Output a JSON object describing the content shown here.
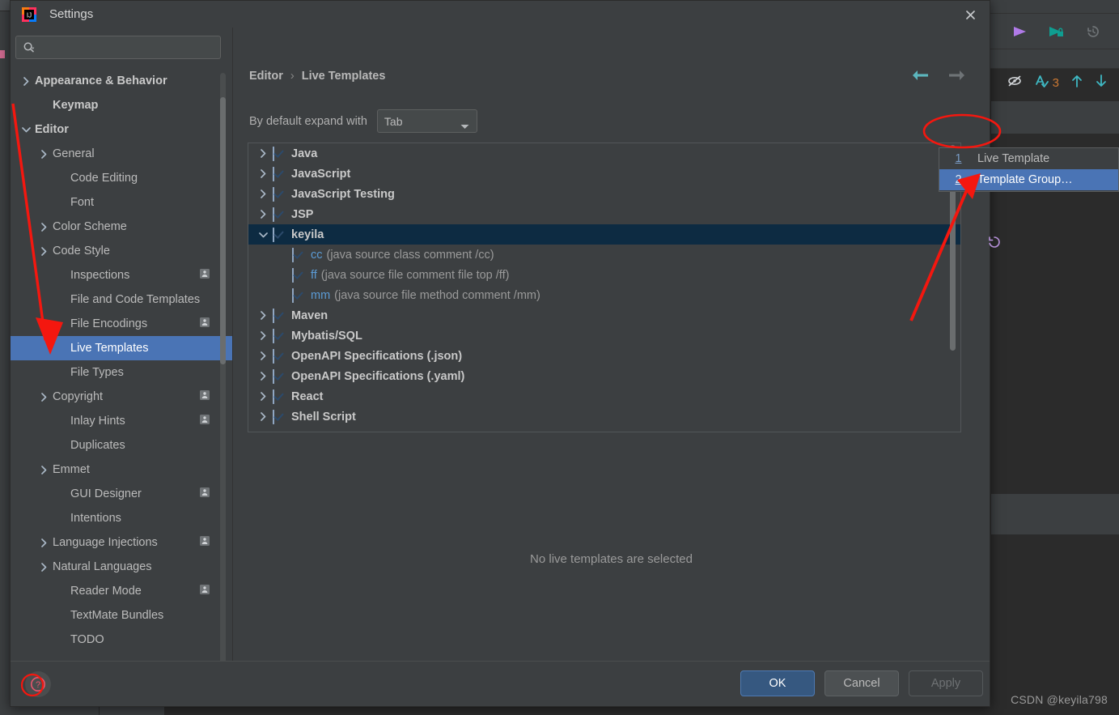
{
  "dialog": {
    "title": "Settings",
    "logo_icon": "intellij-idea-logo-icon",
    "close_icon": "close-icon",
    "search": {
      "placeholder": "",
      "value": "",
      "icon": "search-dropdown-icon"
    },
    "breadcrumb": {
      "root": "Editor",
      "separator": "›",
      "current": "Live Templates"
    },
    "nav": {
      "back_icon": "arrow-left-icon",
      "forward_icon": "arrow-right-icon",
      "back_color": "#5cb6bd",
      "forward_color": "#6e7376"
    },
    "expand_with": {
      "label": "By default expand with",
      "value": "Tab",
      "chevron_icon": "chevron-down-icon"
    },
    "empty_message": "No live templates are selected",
    "toolbar": {
      "add_icon": "plus-icon",
      "add_color": "#3fb9c4",
      "revert_icon": "revert-undo-icon"
    },
    "footer": {
      "help_icon": "help-question-icon",
      "ok_label": "OK",
      "cancel_label": "Cancel",
      "apply_label": "Apply"
    }
  },
  "sidebar": {
    "items": [
      {
        "label": "Appearance & Behavior",
        "twisty": "chevron-right-icon",
        "bold": true,
        "indent": 0,
        "badge": false,
        "selected": false
      },
      {
        "label": "Keymap",
        "twisty": "",
        "bold": true,
        "indent": 1,
        "badge": false,
        "selected": false
      },
      {
        "label": "Editor",
        "twisty": "chevron-down-icon",
        "bold": true,
        "indent": 0,
        "badge": false,
        "selected": false
      },
      {
        "label": "General",
        "twisty": "chevron-right-icon",
        "bold": false,
        "indent": 1,
        "badge": false,
        "selected": false
      },
      {
        "label": "Code Editing",
        "twisty": "",
        "bold": false,
        "indent": 2,
        "badge": false,
        "selected": false
      },
      {
        "label": "Font",
        "twisty": "",
        "bold": false,
        "indent": 2,
        "badge": false,
        "selected": false
      },
      {
        "label": "Color Scheme",
        "twisty": "chevron-right-icon",
        "bold": false,
        "indent": 1,
        "badge": false,
        "selected": false
      },
      {
        "label": "Code Style",
        "twisty": "chevron-right-icon",
        "bold": false,
        "indent": 1,
        "badge": false,
        "selected": false
      },
      {
        "label": "Inspections",
        "twisty": "",
        "bold": false,
        "indent": 2,
        "badge": true,
        "selected": false
      },
      {
        "label": "File and Code Templates",
        "twisty": "",
        "bold": false,
        "indent": 2,
        "badge": false,
        "selected": false
      },
      {
        "label": "File Encodings",
        "twisty": "",
        "bold": false,
        "indent": 2,
        "badge": true,
        "selected": false
      },
      {
        "label": "Live Templates",
        "twisty": "",
        "bold": false,
        "indent": 2,
        "badge": false,
        "selected": true
      },
      {
        "label": "File Types",
        "twisty": "",
        "bold": false,
        "indent": 2,
        "badge": false,
        "selected": false
      },
      {
        "label": "Copyright",
        "twisty": "chevron-right-icon",
        "bold": false,
        "indent": 1,
        "badge": true,
        "selected": false
      },
      {
        "label": "Inlay Hints",
        "twisty": "",
        "bold": false,
        "indent": 2,
        "badge": true,
        "selected": false
      },
      {
        "label": "Duplicates",
        "twisty": "",
        "bold": false,
        "indent": 2,
        "badge": false,
        "selected": false
      },
      {
        "label": "Emmet",
        "twisty": "chevron-right-icon",
        "bold": false,
        "indent": 1,
        "badge": false,
        "selected": false
      },
      {
        "label": "GUI Designer",
        "twisty": "",
        "bold": false,
        "indent": 2,
        "badge": true,
        "selected": false
      },
      {
        "label": "Intentions",
        "twisty": "",
        "bold": false,
        "indent": 2,
        "badge": false,
        "selected": false
      },
      {
        "label": "Language Injections",
        "twisty": "chevron-right-icon",
        "bold": false,
        "indent": 1,
        "badge": true,
        "selected": false
      },
      {
        "label": "Natural Languages",
        "twisty": "chevron-right-icon",
        "bold": false,
        "indent": 1,
        "badge": false,
        "selected": false
      },
      {
        "label": "Reader Mode",
        "twisty": "",
        "bold": false,
        "indent": 2,
        "badge": true,
        "selected": false
      },
      {
        "label": "TextMate Bundles",
        "twisty": "",
        "bold": false,
        "indent": 2,
        "badge": false,
        "selected": false
      },
      {
        "label": "TODO",
        "twisty": "",
        "bold": false,
        "indent": 2,
        "badge": false,
        "selected": false
      }
    ]
  },
  "templates": {
    "rows": [
      {
        "type": "group",
        "label": "Java",
        "twisty": "chevron-right-icon",
        "checked": true,
        "selected": false
      },
      {
        "type": "group",
        "label": "JavaScript",
        "twisty": "chevron-right-icon",
        "checked": true,
        "selected": false
      },
      {
        "type": "group",
        "label": "JavaScript Testing",
        "twisty": "chevron-right-icon",
        "checked": true,
        "selected": false
      },
      {
        "type": "group",
        "label": "JSP",
        "twisty": "chevron-right-icon",
        "checked": true,
        "selected": false
      },
      {
        "type": "group",
        "label": "keyila",
        "twisty": "chevron-down-icon",
        "checked": true,
        "selected": true
      },
      {
        "type": "child",
        "abbr": "cc",
        "desc": "(java source class comment /cc)",
        "checked": true
      },
      {
        "type": "child",
        "abbr": "ff",
        "desc": "(java source file comment file top /ff)",
        "checked": true
      },
      {
        "type": "child",
        "abbr": "mm",
        "desc": "(java source file method comment /mm)",
        "checked": true
      },
      {
        "type": "group",
        "label": "Maven",
        "twisty": "chevron-right-icon",
        "checked": true,
        "selected": false
      },
      {
        "type": "group",
        "label": "Mybatis/SQL",
        "twisty": "chevron-right-icon",
        "checked": true,
        "selected": false
      },
      {
        "type": "group",
        "label": "OpenAPI Specifications (.json)",
        "twisty": "chevron-right-icon",
        "checked": true,
        "selected": false
      },
      {
        "type": "group",
        "label": "OpenAPI Specifications (.yaml)",
        "twisty": "chevron-right-icon",
        "checked": true,
        "selected": false
      },
      {
        "type": "group",
        "label": "React",
        "twisty": "chevron-right-icon",
        "checked": true,
        "selected": false
      },
      {
        "type": "group",
        "label": "Shell Script",
        "twisty": "chevron-right-icon",
        "checked": true,
        "selected": false
      }
    ]
  },
  "popup_menu": {
    "items": [
      {
        "mnemonic": "1",
        "label": "Live Template",
        "highlighted": false
      },
      {
        "mnemonic": "2",
        "label": "Template Group…",
        "highlighted": true
      }
    ]
  },
  "ide_background": {
    "toolbar_icons": [
      {
        "name": "download-icon",
        "color": "#e8744f"
      },
      {
        "name": "run-play-icon",
        "color": "#b07ae8"
      },
      {
        "name": "debug-secure-run-icon",
        "color": "#0f9e91"
      },
      {
        "name": "history-clock-icon",
        "color": "#6e7376"
      }
    ],
    "inspection_widget": {
      "hide_icon": "eye-slash-icon",
      "analyze_icon": "analyze-a-icon",
      "count": "3",
      "up_icon": "arrow-up-icon",
      "down_icon": "arrow-down-icon",
      "accent": "#3fb9c4"
    },
    "watermark": "CSDN @keyila798"
  },
  "annotations": {
    "accent_color": "#f4170f",
    "marks": [
      {
        "name": "arrow-to-live-templates",
        "type": "arrow"
      },
      {
        "name": "arrow-to-template-group",
        "type": "arrow"
      },
      {
        "name": "ellipse-around-add-button",
        "type": "ellipse"
      },
      {
        "name": "ellipse-around-help-button",
        "type": "ellipse"
      }
    ]
  }
}
